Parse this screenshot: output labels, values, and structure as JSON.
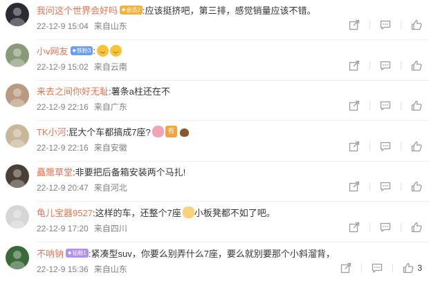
{
  "comments": [
    {
      "username": "我问这个世界会好吗",
      "badge": {
        "label": "会员2",
        "style": "gold"
      },
      "text": ":应该挺挤吧，第三排，感觉销量应该不错。",
      "emojis": [],
      "date": "22-12-9 15:04",
      "source": "来自山东",
      "likes": "",
      "avatar_color": "#2b2b33"
    },
    {
      "username": "小v网友",
      "badge": {
        "label": "铁粉3",
        "style": "blue"
      },
      "text": ":",
      "emojis": [
        "smile-emoji",
        "smile-emoji"
      ],
      "date": "22-12-9 15:02",
      "source": "来自云南",
      "likes": "",
      "avatar_color": "#8a9a78"
    },
    {
      "username": "来去之间你好无耻",
      "badge": null,
      "text": ":薯条a柱还在不",
      "emojis": [],
      "date": "22-12-9 22:16",
      "source": "来自广东",
      "likes": "",
      "avatar_color": "#b99a80"
    },
    {
      "username": "TK小河",
      "badge": null,
      "text": ":屁大个车都搞成7座?",
      "emojis": [
        "brain-emoji",
        "you-emoji",
        "poo-emoji"
      ],
      "date": "22-12-9 22:16",
      "source": "来自安徽",
      "likes": "",
      "avatar_color": "#c9b79a"
    },
    {
      "username": "矗鬶草堂",
      "badge": null,
      "text": ":非要把后备箱安装两个马扎!",
      "emojis": [],
      "date": "22-12-9 20:47",
      "source": "来自河北",
      "likes": "",
      "avatar_color": "#4a4038"
    },
    {
      "username": "龟儿宝器9527",
      "badge": null,
      "text": ":这样的车，还整个7座",
      "text_after": "小板凳都不如了吧。",
      "emojis": [
        "cat-emoji"
      ],
      "date": "22-12-9 17:20",
      "source": "来自四川",
      "likes": "",
      "avatar_color": "#d6d6d6"
    },
    {
      "username": "不呐钠",
      "badge": {
        "label": "钻粉1",
        "style": "purple"
      },
      "text": ":紧凑型suv，你要么别弄什么7座，要么就别要那个小斜溜背，",
      "emojis": [],
      "date": "22-12-9 15:36",
      "source": "来自山东",
      "likes": "3",
      "avatar_color": "#3a6a3a"
    }
  ],
  "icons": {
    "share": "share-icon",
    "reply": "comment-icon",
    "like": "thumbs-up-icon"
  },
  "colors": {
    "username": "#eb7350",
    "meta": "#808080",
    "icon": "#9a9a9a"
  }
}
